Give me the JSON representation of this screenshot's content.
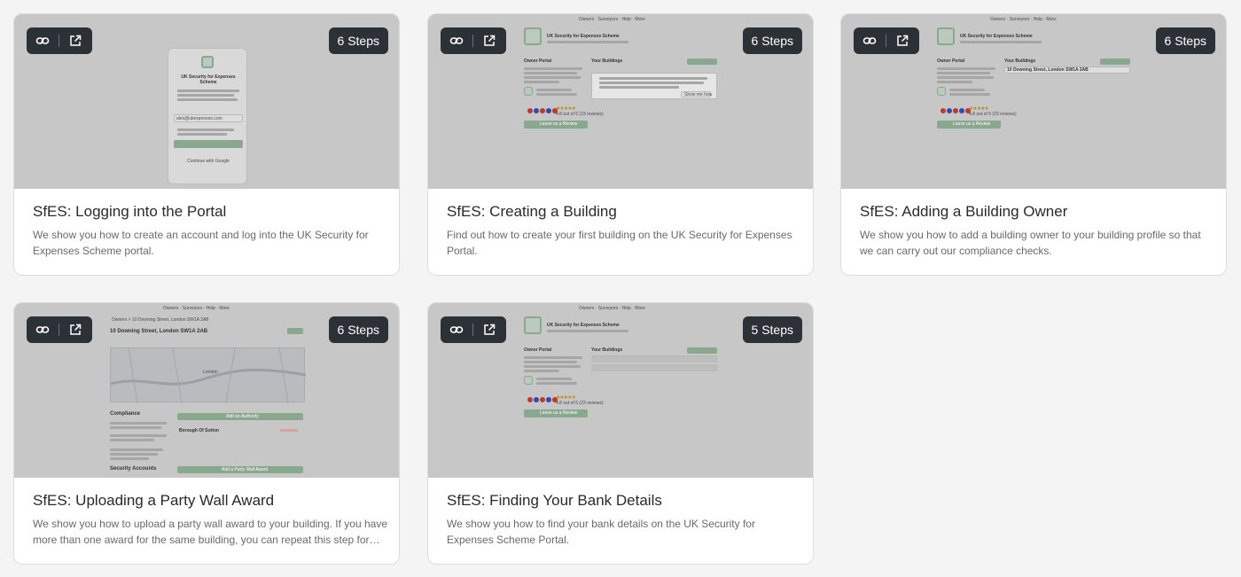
{
  "colors": {
    "pill_bg": "#2c3138",
    "thumb_bg": "#c7c7c7",
    "accent_green": "#8aa88e",
    "card_bg": "#ffffff"
  },
  "icons": {
    "copy_link": "link-icon",
    "open_new": "external-link-icon"
  },
  "cards": [
    {
      "steps": "6 Steps",
      "title": "SfES: Logging into the Portal",
      "description": "We show you how to create an account and log into the UK Security for Expenses Scheme portal.",
      "preview": {
        "heading": "UK Security for Expenses Scheme",
        "email": "alex@ukexpenses.com",
        "link": "Continue with Google"
      }
    },
    {
      "steps": "6 Steps",
      "title": "SfES: Creating a Building",
      "description": "Find out how to create your first building on the UK Security for Expenses Portal.",
      "preview": {
        "nav": [
          "Owners",
          "Surveyors",
          "Help",
          "More"
        ],
        "brand": "UK Security for Expenses Scheme",
        "left_heading": "Owner Portal",
        "right_heading": "Your Buildings",
        "rating": "4.8 out of 5 (23 reviews)",
        "button": "Leave us a Review",
        "hint_button": "Show me how"
      }
    },
    {
      "steps": "6 Steps",
      "title": "SfES: Adding a Building Owner",
      "description": "We show you how to add a building owner to your building profile so that we can carry out our compliance checks.",
      "preview": {
        "nav": [
          "Owners",
          "Surveyors",
          "Help",
          "More"
        ],
        "brand": "UK Security for Expenses Scheme",
        "left_heading": "Owner Portal",
        "right_heading": "Your Buildings",
        "building": "10 Downing Street, London SW1A 2AB",
        "rating": "4.8 out of 5 (23 reviews)",
        "button": "Leave us a Review"
      }
    },
    {
      "steps": "6 Steps",
      "title": "SfES: Uploading a Party Wall Award",
      "description": "We show you how to upload a party wall award to your building. If you have more than one award for the same building, you can repeat this step for each one.",
      "preview": {
        "nav": [
          "Owners",
          "Surveyors",
          "Help",
          "More"
        ],
        "breadcrumb": "Owners > 10 Downing Street, London SW1A 2AB",
        "address": "10 Downing Street, London SW1A 2AB",
        "map_label": "London",
        "section1": "Compliance",
        "section2": "Security Accounts",
        "council": "Borough Of Sutton",
        "button1": "Add an Authority",
        "button2": "Add a Party Wall Award"
      }
    },
    {
      "steps": "5 Steps",
      "title": "SfES: Finding Your Bank Details",
      "description": "We show you how to find your bank details on the UK Security for Expenses Scheme Portal.",
      "preview": {
        "nav": [
          "Owners",
          "Surveyors",
          "Help",
          "More"
        ],
        "brand": "UK Security for Expenses Scheme",
        "left_heading": "Owner Portal",
        "right_heading": "Your Buildings",
        "rating": "4.8 out of 5 (23 reviews)",
        "button": "Leave us a Review"
      }
    }
  ]
}
